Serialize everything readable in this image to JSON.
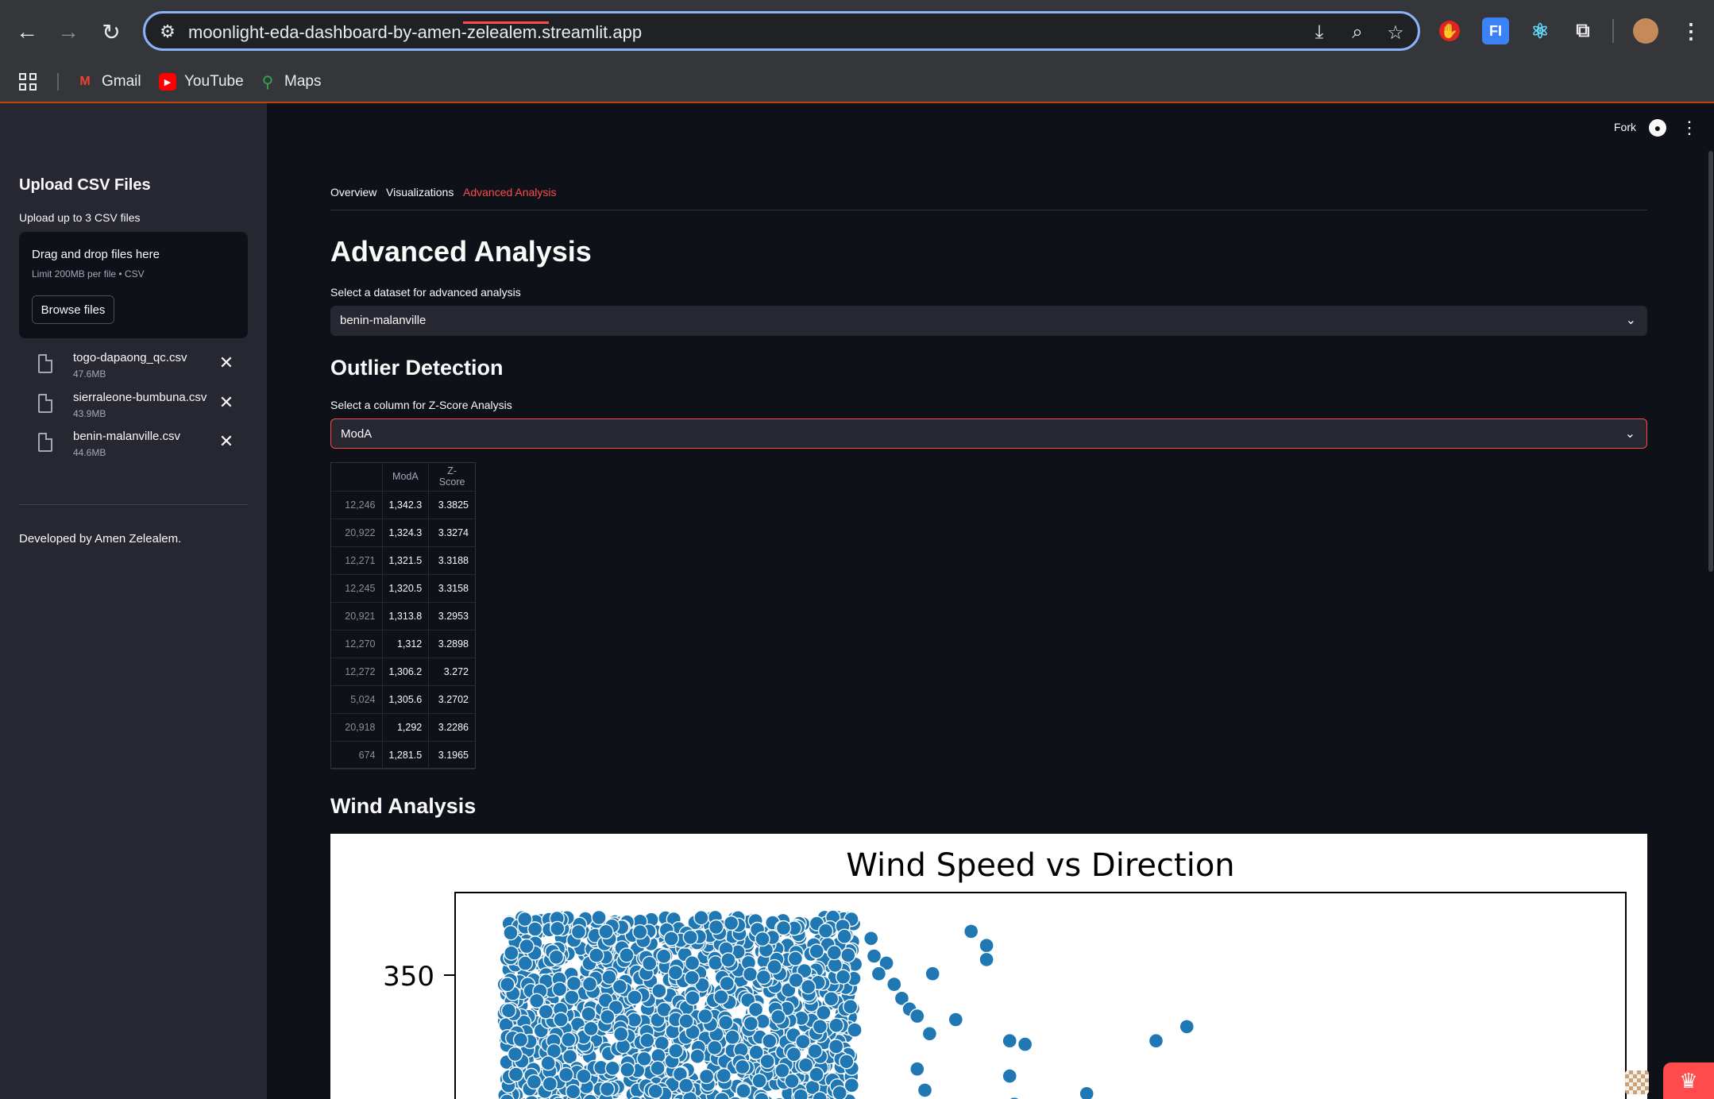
{
  "browser": {
    "url": "moonlight-eda-dashboard-by-amen-zelealem.streamlit.app",
    "bookmarks": [
      {
        "label": "Gmail",
        "color": "#ea4335"
      },
      {
        "label": "YouTube",
        "color": "#ff0000"
      },
      {
        "label": "Maps",
        "color": "#34a853"
      }
    ],
    "extensions": [
      {
        "icon": "hand-stop-extension-icon",
        "color": "#e02424"
      },
      {
        "icon": "fi-extension-icon",
        "label": "FI",
        "color": "#3b82f6"
      },
      {
        "icon": "react-extension-icon",
        "color": "#61dafb"
      }
    ]
  },
  "sidebar": {
    "title": "Upload CSV Files",
    "subtitle": "Upload up to 3 CSV files",
    "dropzone_title": "Drag and drop files here",
    "dropzone_limit": "Limit 200MB per file • CSV",
    "browse_label": "Browse files",
    "files": [
      {
        "name": "togo-dapaong_qc.csv",
        "size": "47.6MB"
      },
      {
        "name": "sierraleone-bumbuna.csv",
        "size": "43.9MB"
      },
      {
        "name": "benin-malanville.csv",
        "size": "44.6MB"
      }
    ],
    "footer": "Developed by Amen Zelealem."
  },
  "header": {
    "fork_label": "Fork"
  },
  "tabs": [
    {
      "label": "Overview",
      "active": false
    },
    {
      "label": "Visualizations",
      "active": false
    },
    {
      "label": "Advanced Analysis",
      "active": true
    }
  ],
  "main": {
    "title": "Advanced Analysis",
    "dataset_label": "Select a dataset for advanced analysis",
    "dataset_value": "benin-malanville",
    "outlier_heading": "Outlier Detection",
    "column_label": "Select a column for Z-Score Analysis",
    "column_value": "ModA",
    "wind_heading": "Wind Analysis"
  },
  "outlier_table": {
    "columns": [
      "",
      "ModA",
      "Z-Score"
    ],
    "rows": [
      [
        "12,246",
        "1,342.3",
        "3.3825"
      ],
      [
        "20,922",
        "1,324.3",
        "3.3274"
      ],
      [
        "12,271",
        "1,321.5",
        "3.3188"
      ],
      [
        "12,245",
        "1,320.5",
        "3.3158"
      ],
      [
        "20,921",
        "1,313.8",
        "3.2953"
      ],
      [
        "12,270",
        "1,312",
        "3.2898"
      ],
      [
        "12,272",
        "1,306.2",
        "3.272"
      ],
      [
        "5,024",
        "1,305.6",
        "3.2702"
      ],
      [
        "20,918",
        "1,292",
        "3.2286"
      ],
      [
        "674",
        "1,281.5",
        "3.1965"
      ]
    ]
  },
  "chart_data": {
    "type": "scatter",
    "title": "Wind Speed vs Direction",
    "ytick_labels": [
      "350"
    ],
    "marker_color": "#1f77b4",
    "visible_y_range": [
      305,
      368
    ],
    "x_range": [
      0,
      7.6
    ],
    "points": [
      {
        "x": 2.7,
        "y": 355
      },
      {
        "x": 2.72,
        "y": 350
      },
      {
        "x": 2.8,
        "y": 348
      },
      {
        "x": 2.75,
        "y": 345
      },
      {
        "x": 2.85,
        "y": 342
      },
      {
        "x": 2.9,
        "y": 338
      },
      {
        "x": 2.95,
        "y": 335
      },
      {
        "x": 3.0,
        "y": 333
      },
      {
        "x": 3.1,
        "y": 345
      },
      {
        "x": 3.08,
        "y": 328
      },
      {
        "x": 3.0,
        "y": 318
      },
      {
        "x": 3.05,
        "y": 312
      },
      {
        "x": 3.35,
        "y": 357
      },
      {
        "x": 3.45,
        "y": 353
      },
      {
        "x": 3.45,
        "y": 349
      },
      {
        "x": 3.25,
        "y": 332
      },
      {
        "x": 3.6,
        "y": 326
      },
      {
        "x": 3.7,
        "y": 325
      },
      {
        "x": 3.6,
        "y": 316
      },
      {
        "x": 3.63,
        "y": 308
      },
      {
        "x": 4.1,
        "y": 311
      },
      {
        "x": 4.55,
        "y": 326
      },
      {
        "x": 4.75,
        "y": 330
      }
    ],
    "dense_region": {
      "x_min": 0.0,
      "x_max": 2.6,
      "y_min": 305,
      "y_max": 361
    }
  }
}
